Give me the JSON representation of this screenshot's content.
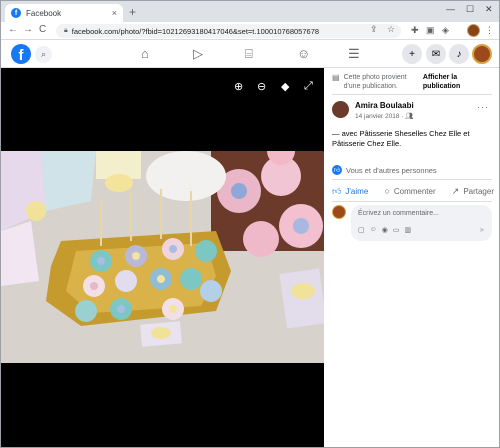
{
  "browser": {
    "tab_title": "Facebook",
    "tab_favicon": "f",
    "tab_close": "×",
    "new_tab": "+",
    "minimize": "—",
    "maximize": "☐",
    "close": "✕",
    "back": "←",
    "forward": "→",
    "reload": "C",
    "url": "facebook.com/photo/?fbid=10212693180417046&set=t.100010768057678"
  },
  "fb_header": {
    "logo": "f"
  },
  "viewer": {
    "zoom_in": "⊕",
    "zoom_out": "⊖",
    "tag": "◆",
    "fullscreen": "⤢"
  },
  "panel": {
    "notice_text": "Cette photo provient d'une publication.",
    "notice_action": "Afficher la publication",
    "author_name": "Amira Boulaabi",
    "post_date": "14 janvier 2018 · ",
    "more": "···",
    "caption": "— avec Pâtisserie Sheselles Chez Elle et Pâtisserie Chez Elle.",
    "reactions": "Vous et d'autres personnes",
    "like_label": "J'aime",
    "comment_label": "Commenter",
    "share_label": "Partager",
    "comment_placeholder": "Écrivez un commentaire..."
  },
  "colors": {
    "facebook_blue": "#1877f2",
    "viewer_bg": "#000000"
  }
}
